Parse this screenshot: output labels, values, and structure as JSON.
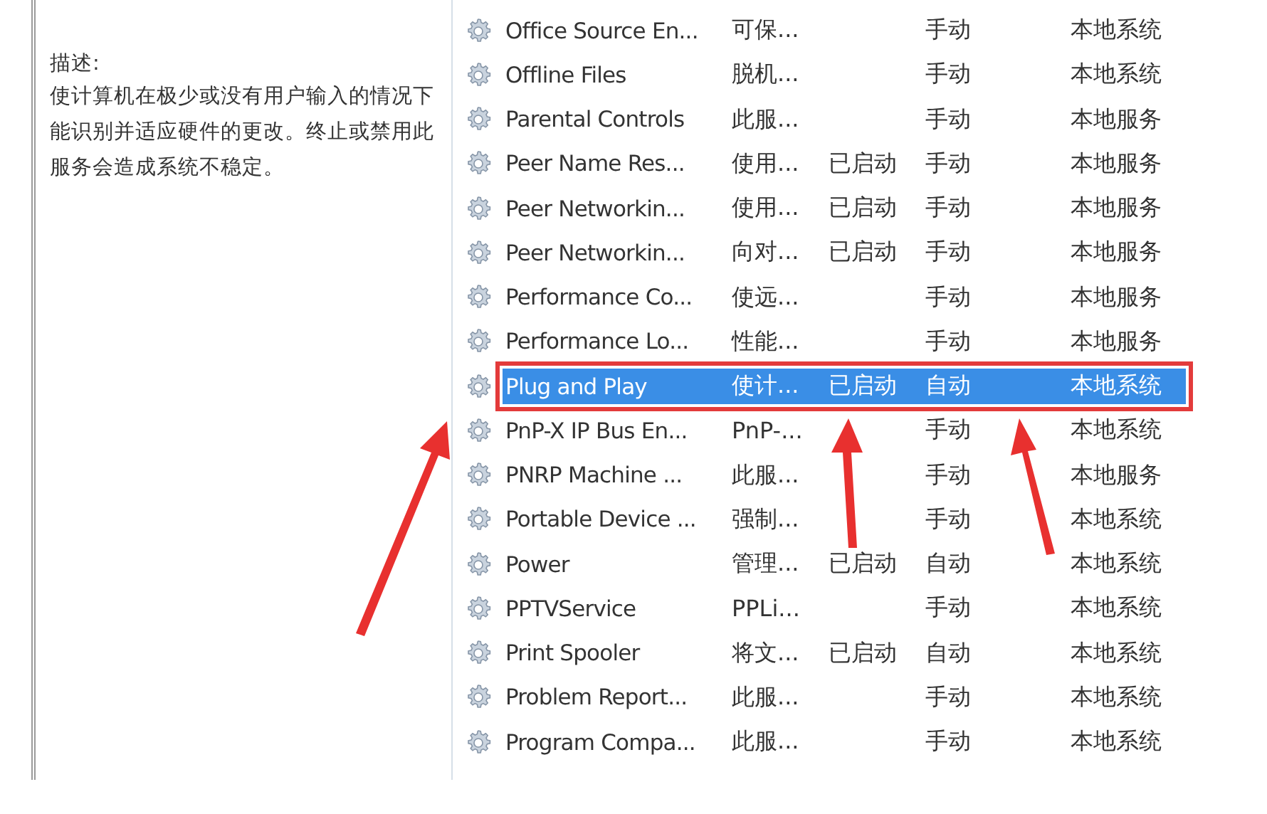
{
  "description": {
    "label": "描述:",
    "text": "使计算机在极少或没有用户输入的情况下能识别并适应硬件的更改。终止或禁用此服务会造成系统不稳定。"
  },
  "services": [
    {
      "name": "Office Source En...",
      "description": "可保...",
      "startup": "手动",
      "logon": "本地系统",
      "selected": false
    },
    {
      "name": "Offline Files",
      "description": "脱机...",
      "startup": "手动",
      "logon": "本地系统",
      "selected": false
    },
    {
      "name": "Parental Controls",
      "description": "此服...",
      "startup": "手动",
      "logon": "本地服务",
      "selected": false
    },
    {
      "name": "Peer Name Res...",
      "description": "使用...",
      "status": "已启动",
      "startup": "手动",
      "logon": "本地服务",
      "selected": false
    },
    {
      "name": "Peer Networkin...",
      "description": "使用...",
      "status": "已启动",
      "startup": "手动",
      "logon": "本地服务",
      "selected": false
    },
    {
      "name": "Peer Networkin...",
      "description": "向对...",
      "status": "已启动",
      "startup": "手动",
      "logon": "本地服务",
      "selected": false
    },
    {
      "name": "Performance Co...",
      "description": "使远...",
      "startup": "手动",
      "logon": "本地服务",
      "selected": false
    },
    {
      "name": "Performance Lo...",
      "description": "性能...",
      "startup": "手动",
      "logon": "本地服务",
      "selected": false
    },
    {
      "name": "Plug and Play",
      "description": "使计...",
      "status": "已启动",
      "startup": "自动",
      "logon": "本地系统",
      "selected": true
    },
    {
      "name": "PnP-X IP Bus En...",
      "description": "PnP-...",
      "startup": "手动",
      "logon": "本地系统",
      "selected": false
    },
    {
      "name": "PNRP Machine ...",
      "description": "此服...",
      "startup": "手动",
      "logon": "本地服务",
      "selected": false
    },
    {
      "name": "Portable Device ...",
      "description": "强制...",
      "startup": "手动",
      "logon": "本地系统",
      "selected": false
    },
    {
      "name": "Power",
      "description": "管理...",
      "status": "已启动",
      "startup": "自动",
      "logon": "本地系统",
      "selected": false
    },
    {
      "name": "PPTVService",
      "description": "PPLi...",
      "startup": "手动",
      "logon": "本地系统",
      "selected": false
    },
    {
      "name": "Print Spooler",
      "description": "将文...",
      "status": "已启动",
      "startup": "自动",
      "logon": "本地系统",
      "selected": false
    },
    {
      "name": "Problem Report...",
      "description": "此服...",
      "startup": "手动",
      "logon": "本地系统",
      "selected": false
    },
    {
      "name": "Program Compa...",
      "description": "此服...",
      "startup": "手动",
      "logon": "本地系统",
      "selected": false
    }
  ]
}
